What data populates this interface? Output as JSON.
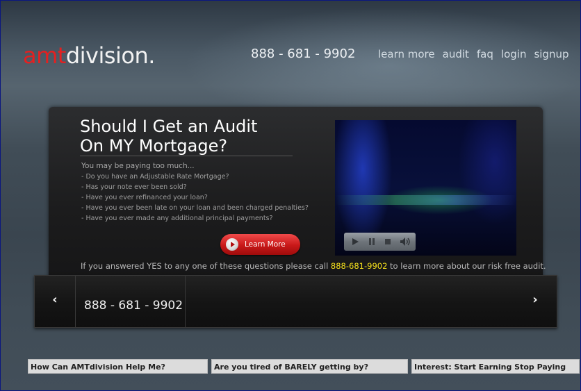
{
  "header": {
    "logo_accent": "amt",
    "logo_rest": "division.",
    "phone": "888 - 681 - 9902",
    "nav": [
      "learn more",
      "audit",
      "faq",
      "login",
      "signup"
    ]
  },
  "hero": {
    "title_line1": "Should I Get an Audit",
    "title_line2": "On MY Mortgage?",
    "intro": "You may be paying too much...",
    "questions": [
      "- Do you have an Adjustable Rate Mortgage?",
      "- Has your note ever been sold?",
      "- Have you ever refinanced your loan?",
      "- Have you ever been late on your loan and been charged penalties?",
      "- Have you ever made any additional principal payments?"
    ],
    "learn_more_label": "Learn More",
    "cta_before": "If you answered YES to any one of these questions please call ",
    "cta_phone": "888-681-9902",
    "cta_after": " to learn more about our risk free audit."
  },
  "video": {
    "controls": [
      "play-icon",
      "pause-icon",
      "stop-icon",
      "volume-icon"
    ]
  },
  "slider": {
    "prev_arrow": "‹",
    "next_arrow": "›",
    "phone": "888 - 681 - 9902"
  },
  "footer_tabs": [
    "How Can AMTdivision Help Me?",
    "Are you tired of BARELY getting by?",
    "Interest: Start Earning Stop Paying"
  ],
  "colors": {
    "accent_red": "#e52020",
    "highlight_yellow": "#f6e11c",
    "button_red": "#c81818"
  }
}
